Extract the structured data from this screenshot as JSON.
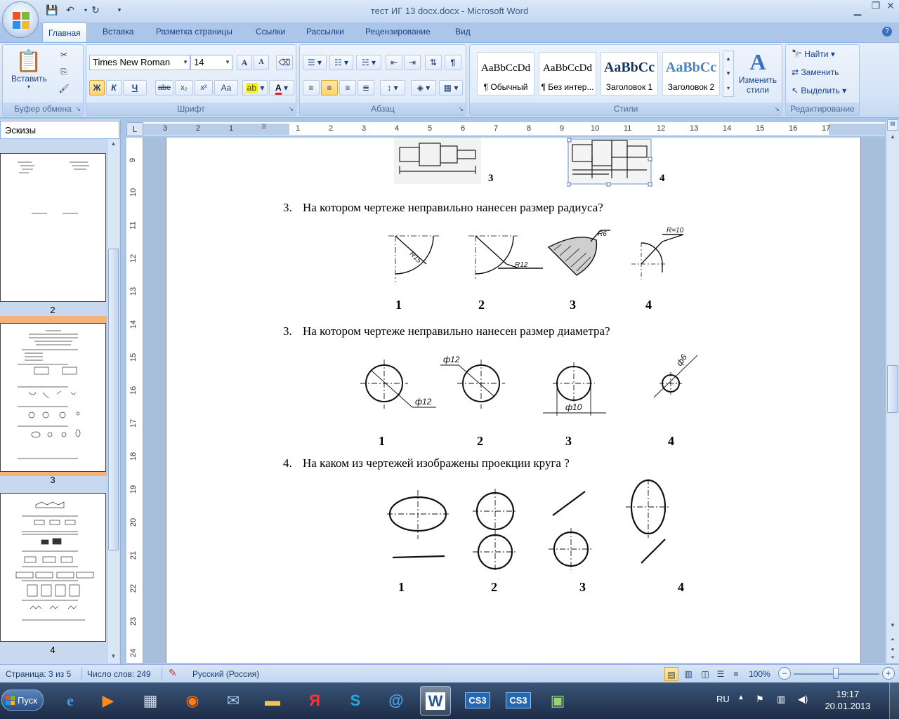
{
  "window": {
    "title": "тест ИГ 13 docx.docx - Microsoft Word"
  },
  "ribbon": {
    "tabs": [
      "Главная",
      "Вставка",
      "Разметка страницы",
      "Ссылки",
      "Рассылки",
      "Рецензирование",
      "Вид"
    ],
    "active_tab": "Главная",
    "clipboard": {
      "label": "Буфер обмена",
      "paste": "Вставить"
    },
    "font": {
      "label": "Шрифт",
      "family": "Times New Roman",
      "size": "14",
      "bold": "Ж",
      "italic": "К",
      "underline": "Ч",
      "strike": "abe",
      "sub": "x₂",
      "sup": "x²",
      "case": "Aa",
      "grow": "A",
      "shrink": "A"
    },
    "paragraph": {
      "label": "Абзац"
    },
    "styles": {
      "label": "Стили",
      "items": [
        {
          "sample": "AaBbCcDd",
          "name": "¶ Обычный"
        },
        {
          "sample": "AaBbCcDd",
          "name": "¶ Без интер..."
        },
        {
          "sample": "AaBbCc",
          "name": "Заголовок 1"
        },
        {
          "sample": "AaBbCc",
          "name": "Заголовок 2"
        }
      ],
      "change_styles": "Изменить стили"
    },
    "editing": {
      "label": "Редактирование",
      "find": "Найти",
      "replace": "Заменить",
      "select": "Выделить"
    }
  },
  "nav_pane": {
    "title": "Эскизы",
    "pages": [
      "2",
      "3",
      "4"
    ],
    "selected": "3"
  },
  "ruler": {
    "h_labels": [
      "3",
      "2",
      "1",
      "1",
      "2",
      "3",
      "4",
      "5",
      "6",
      "7",
      "8",
      "9",
      "10",
      "11",
      "12",
      "13",
      "14",
      "15",
      "16",
      "17"
    ],
    "v_labels": [
      "9",
      "10",
      "11",
      "12",
      "13",
      "14",
      "15",
      "16",
      "17",
      "18",
      "19",
      "20",
      "21",
      "22",
      "23",
      "24"
    ],
    "corner": "L"
  },
  "document": {
    "prev_labels": [
      "3",
      "4"
    ],
    "questions": [
      {
        "num": "3.",
        "text": "На котором чертеже неправильно нанесен размер радиуса?",
        "labels": [
          "1",
          "2",
          "3",
          "4"
        ],
        "dims": [
          "R15",
          "R12",
          "R6",
          "R=10"
        ]
      },
      {
        "num": "3.",
        "text": "На котором чертеже неправильно нанесен размер диаметра?",
        "labels": [
          "1",
          "2",
          "3",
          "4"
        ],
        "dims": [
          "ф12",
          "ф12",
          "ф10",
          "ф6"
        ]
      },
      {
        "num": "4.",
        "text": "На каком из чертежей изображены проекции круга ?",
        "labels": [
          "1",
          "2",
          "3",
          "4"
        ]
      }
    ]
  },
  "status": {
    "page": "Страница: 3 из 5",
    "words": "Число слов: 249",
    "language": "Русский (Россия)",
    "zoom": "100%"
  },
  "taskbar": {
    "start": "Пуск",
    "lang": "RU",
    "time": "19:17",
    "date": "20.01.2013",
    "apps": [
      "internet-explorer",
      "media-player",
      "calculator",
      "firefox",
      "mail",
      "folder",
      "yandex",
      "skype",
      "mail-agent",
      "word",
      "cs3",
      "cs3",
      "picture-viewer"
    ],
    "cs3_label": "CS3"
  }
}
